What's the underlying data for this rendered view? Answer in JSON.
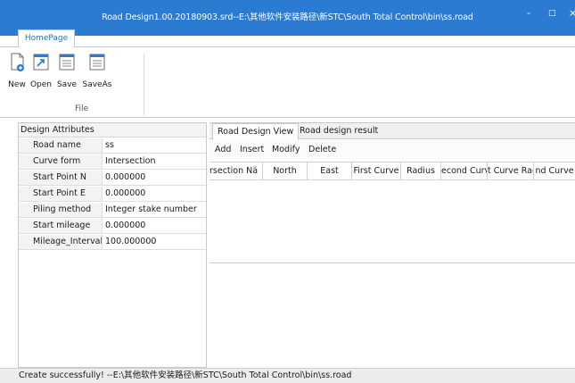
{
  "window": {
    "title": "Road Design1.00.20180903.srd--E:\\其他软件安装路径\\新STC\\South Total Control\\bin\\ss.road",
    "minimize": "-",
    "maximize": "□",
    "close": "×"
  },
  "ribbon": {
    "tab": "HomePage",
    "buttons": [
      {
        "label": "New",
        "icon": "new-file-icon"
      },
      {
        "label": "Open",
        "icon": "open-file-icon"
      },
      {
        "label": "Save",
        "icon": "save-icon"
      },
      {
        "label": "SaveAs",
        "icon": "save-as-icon"
      }
    ],
    "group_label": "File"
  },
  "design_attributes": {
    "title": "Design Attributes",
    "rows": [
      {
        "key": "Road name",
        "value": "ss"
      },
      {
        "key": "Curve form",
        "value": "Intersection"
      },
      {
        "key": "Start Point N",
        "value": "0.000000"
      },
      {
        "key": "Start Point E",
        "value": "0.000000"
      },
      {
        "key": "Piling method",
        "value": "Integer stake number"
      },
      {
        "key": "Start mileage",
        "value": "0.000000"
      },
      {
        "key": "Mileage_Interval",
        "value": "100.000000"
      }
    ]
  },
  "main": {
    "tabs": [
      {
        "label": "Road Design View",
        "active": true
      },
      {
        "label": "Road design result",
        "active": false
      }
    ],
    "toolbar": [
      "Add",
      "Insert",
      "Modify",
      "Delete"
    ],
    "columns": [
      "rsection Nä",
      "North",
      "East",
      "First Curve",
      "Radius",
      "econd Curv",
      "t Curve Rac",
      "nd Curve"
    ]
  },
  "status": {
    "text": "Create successfully!  --E:\\其他软件安装路径\\新STC\\South Total Control\\bin\\ss.road"
  },
  "colors": {
    "title_bar": "#2b7bd3",
    "accent_text": "#2b6cb3"
  }
}
